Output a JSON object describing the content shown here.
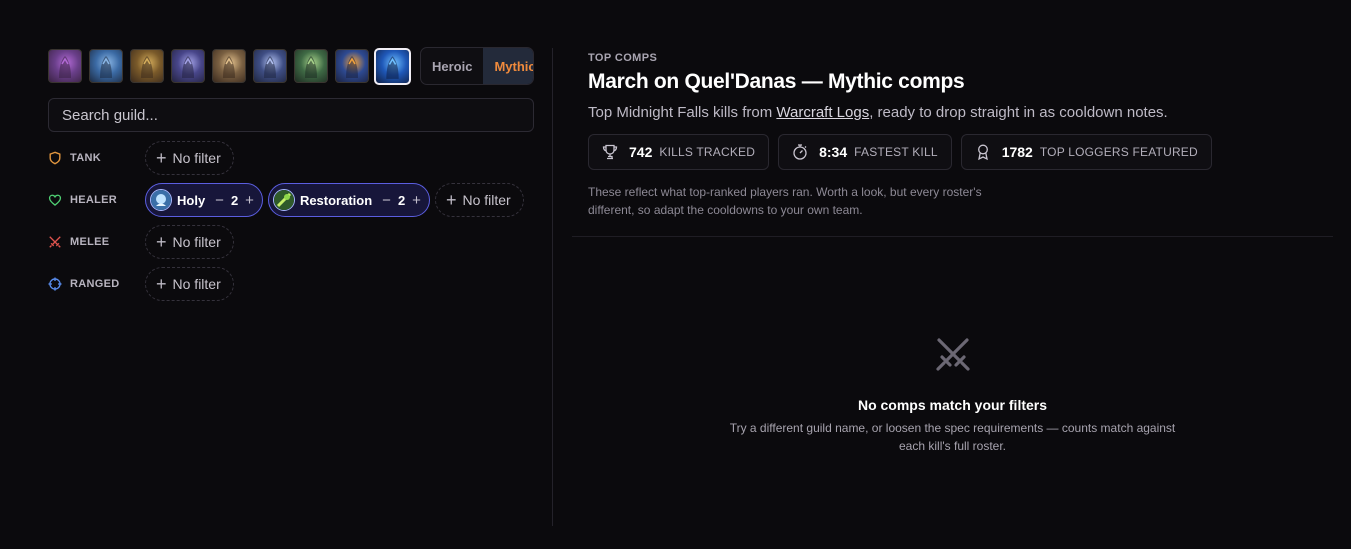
{
  "bosses": [
    {
      "icon": "boss-portrait-1-icon",
      "colors": [
        "#3b2344",
        "#6a3f8a",
        "#b36ad6"
      ]
    },
    {
      "icon": "boss-portrait-2-icon",
      "colors": [
        "#1d2c44",
        "#3b6aa4",
        "#8bb7e6"
      ]
    },
    {
      "icon": "boss-portrait-3-icon",
      "colors": [
        "#3c2b1d",
        "#7a5a2a",
        "#d6ae5c"
      ]
    },
    {
      "icon": "boss-portrait-4-icon",
      "colors": [
        "#242340",
        "#48468a",
        "#a3a2e6"
      ]
    },
    {
      "icon": "boss-portrait-5-icon",
      "colors": [
        "#3a2a1e",
        "#7a6042",
        "#e2c08c"
      ]
    },
    {
      "icon": "boss-portrait-6-icon",
      "colors": [
        "#1f2640",
        "#3f4e84",
        "#b1c0f0"
      ]
    },
    {
      "icon": "boss-portrait-7-icon",
      "colors": [
        "#1e2c22",
        "#3f6a45",
        "#a7d28a"
      ]
    },
    {
      "icon": "boss-portrait-8-icon",
      "colors": [
        "#1c2240",
        "#2e4a92",
        "#f2a23c"
      ]
    },
    {
      "icon": "boss-portrait-9-icon",
      "colors": [
        "#0f1f44",
        "#1f58b8",
        "#6fc0ff"
      ],
      "active": true
    }
  ],
  "difficulty": {
    "options": [
      "Heroic",
      "Mythic"
    ],
    "selected": "Mythic",
    "selected_color": "#f08a3c"
  },
  "search": {
    "placeholder": "Search guild..."
  },
  "roles": {
    "tank": {
      "label": "TANK",
      "icon": "shield-icon",
      "color": "#e0953f"
    },
    "healer": {
      "label": "HEALER",
      "icon": "heart-icon",
      "color": "#4fcf73"
    },
    "melee": {
      "label": "MELEE",
      "icon": "crossed-swords-icon",
      "color": "#e0544e"
    },
    "ranged": {
      "label": "RANGED",
      "icon": "crosshair-icon",
      "color": "#5a8ef0"
    }
  },
  "filters": {
    "no_filter_label": "No filter",
    "healer_specs": [
      {
        "name": "Holy",
        "count": "2",
        "icon": "holy-spec-icon"
      },
      {
        "name": "Restoration",
        "count": "2",
        "icon": "restoration-spec-icon"
      }
    ],
    "decrement": "−",
    "increment": "+"
  },
  "header": {
    "eyebrow": "TOP COMPS",
    "title": "March on Quel'Danas — Mythic comps",
    "subtitle_before": "Top Midnight Falls kills from ",
    "subtitle_link": "Warcraft Logs",
    "subtitle_after": ", ready to drop straight in as cooldown notes."
  },
  "stats": [
    {
      "icon": "trophy-icon",
      "value": "742",
      "label": "KILLS TRACKED"
    },
    {
      "icon": "stopwatch-icon",
      "value": "8:34",
      "label": "FASTEST KILL"
    },
    {
      "icon": "award-ribbon-icon",
      "value": "1782",
      "label": "TOP LOGGERS FEATURED"
    }
  ],
  "note": "These reflect what top-ranked players ran. Worth a look, but every roster's different, so adapt the cooldowns to your own team.",
  "empty_state": {
    "icon": "crossed-swords-icon",
    "title": "No comps match your filters",
    "description_line1": "Try a different guild name, or loosen the spec requirements — counts match against",
    "description_line2": "each kill's full roster."
  }
}
